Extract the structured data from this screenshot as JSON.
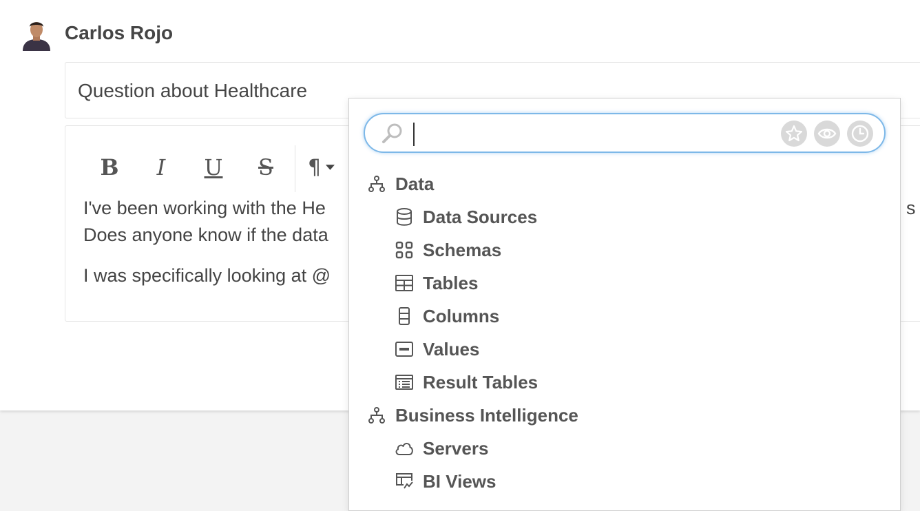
{
  "post": {
    "author": "Carlos Rojo",
    "title": "Question about Healthcare"
  },
  "toolbar": {
    "bold": "B",
    "italic": "I",
    "underline": "U",
    "strikethrough": "S",
    "paragraph": "¶"
  },
  "editor": {
    "line1": "I've been working with the He",
    "line1_tail": "s d",
    "line2": "Does anyone know if the data",
    "line3": "I was specifically looking at @"
  },
  "mention_menu": {
    "search": {
      "value": "",
      "placeholder": ""
    },
    "filters": [
      "star-icon",
      "eye-icon",
      "clock-icon"
    ],
    "groups": [
      {
        "label": "Data",
        "icon": "hierarchy-icon",
        "items": [
          {
            "label": "Data Sources",
            "icon": "database-icon"
          },
          {
            "label": "Schemas",
            "icon": "grid-icon"
          },
          {
            "label": "Tables",
            "icon": "table-icon"
          },
          {
            "label": "Columns",
            "icon": "column-icon"
          },
          {
            "label": "Values",
            "icon": "value-icon"
          },
          {
            "label": "Result Tables",
            "icon": "result-table-icon"
          }
        ]
      },
      {
        "label": "Business Intelligence",
        "icon": "hierarchy-icon",
        "items": [
          {
            "label": "Servers",
            "icon": "cloud-icon"
          },
          {
            "label": "BI Views",
            "icon": "bi-view-icon"
          }
        ]
      }
    ]
  },
  "colors": {
    "focus_ring": "#7db8e8",
    "text": "#555555",
    "filter_bg": "#d9d9d9"
  }
}
